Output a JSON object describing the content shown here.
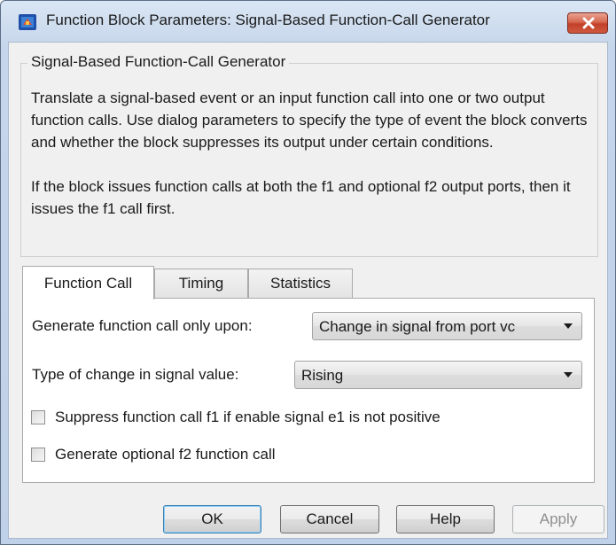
{
  "window": {
    "title": "Function Block Parameters: Signal-Based Function-Call Generator",
    "app_icon": "simulink-block-icon",
    "close_icon": "close-icon"
  },
  "group": {
    "title": "Signal-Based Function-Call Generator",
    "description_1": "Translate a signal-based event or an input function call into one or two output function calls. Use dialog parameters to specify the type of event the block converts and whether the block suppresses its output under certain conditions.",
    "description_2": "If the block issues function calls at both the f1 and optional f2 output ports, then it issues the f1 call first."
  },
  "tabs": [
    {
      "label": "Function Call",
      "active": true
    },
    {
      "label": "Timing",
      "active": false
    },
    {
      "label": "Statistics",
      "active": false
    }
  ],
  "params": {
    "generate_label": "Generate function call only upon:",
    "generate_value": "Change in signal from port vc",
    "change_label": "Type of change in signal value:",
    "change_value": "Rising",
    "suppress_label": "Suppress function call f1 if enable signal e1 is not positive",
    "suppress_checked": false,
    "optional_label": "Generate optional f2 function call",
    "optional_checked": false
  },
  "buttons": {
    "ok": "OK",
    "cancel": "Cancel",
    "help": "Help",
    "apply": "Apply"
  },
  "colors": {
    "close_button": "#c2402a",
    "default_button_border": "#3c7fb1",
    "window_frame": "#c6d6ea"
  }
}
